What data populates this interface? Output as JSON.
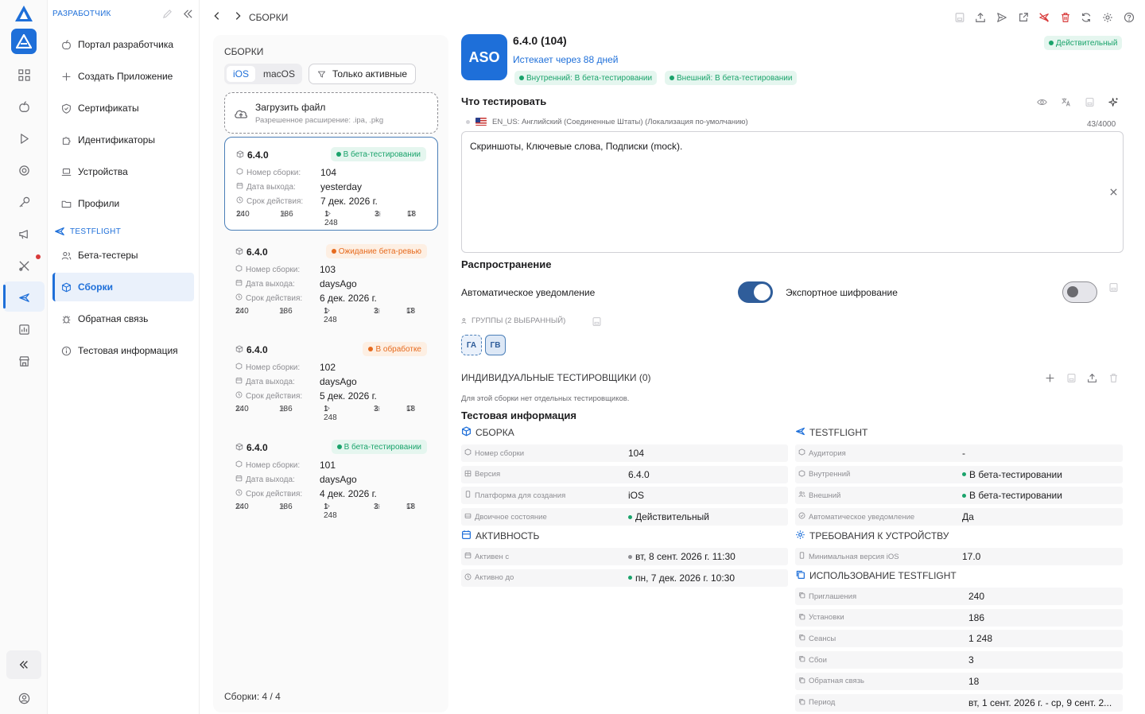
{
  "sidebar": {
    "section_title": "РАЗРАБОТЧИК",
    "items": [
      {
        "label": "Портал разработчика",
        "icon": "apple-icon"
      },
      {
        "label": "Создать Приложение",
        "icon": "plus-icon"
      },
      {
        "label": "Сертификаты",
        "icon": "shield-check-icon"
      },
      {
        "label": "Идентификаторы",
        "icon": "puzzle-icon"
      },
      {
        "label": "Устройства",
        "icon": "laptop-icon"
      },
      {
        "label": "Профили",
        "icon": "folder-icon"
      }
    ],
    "testflight_section": "TESTFLIGHT",
    "testflight_items": [
      {
        "label": "Бета-тестеры",
        "icon": "users-icon"
      },
      {
        "label": "Сборки",
        "icon": "box-icon",
        "active": true
      },
      {
        "label": "Обратная связь",
        "icon": "bug-icon"
      },
      {
        "label": "Тестовая информация",
        "icon": "info-icon"
      }
    ]
  },
  "topbar": {
    "breadcrumb": "СБОРКИ"
  },
  "builds": {
    "title": "СБОРКИ",
    "platforms": [
      "iOS",
      "macOS"
    ],
    "selected_platform": "iOS",
    "filter_label": "Только активные",
    "upload_title": "Загрузить файл",
    "upload_hint": "Разрешенное расширение: .ipa, .pkg",
    "labels": {
      "build_number": "Номер сборки:",
      "release_date": "Дата выхода:",
      "expiry": "Срок действия:"
    },
    "items": [
      {
        "version": "6.4.0",
        "status": "В бета-тестировании",
        "status_color": "green",
        "build": "104",
        "date": "yesterday",
        "expiry": "7 дек. 2026 г.",
        "users": "240",
        "downloads": "186",
        "sessions": "1 248",
        "crashes": "3",
        "feedback": "18"
      },
      {
        "version": "6.4.0",
        "status": "Ожидание бета-ревью",
        "status_color": "orange",
        "build": "103",
        "date": "daysAgo",
        "expiry": "6 дек. 2026 г.",
        "users": "240",
        "downloads": "186",
        "sessions": "1 248",
        "crashes": "3",
        "feedback": "18"
      },
      {
        "version": "6.4.0",
        "status": "В обработке",
        "status_color": "orange",
        "build": "102",
        "date": "daysAgo",
        "expiry": "5 дек. 2026 г.",
        "users": "240",
        "downloads": "186",
        "sessions": "1 248",
        "crashes": "3",
        "feedback": "18"
      },
      {
        "version": "6.4.0",
        "status": "В бета-тестировании",
        "status_color": "green",
        "build": "101",
        "date": "daysAgo",
        "expiry": "4 дек. 2026 г.",
        "users": "240",
        "downloads": "186",
        "sessions": "1 248",
        "crashes": "3",
        "feedback": "18"
      }
    ],
    "footer": "Сборки: 4 / 4"
  },
  "detail": {
    "app_icon_text": "ASO",
    "title": "6.4.0 (104)",
    "expires": "Истекает через 88 дней",
    "internal_pill": "Внутренний: В бета-тестировании",
    "external_pill": "Внешний: В бета-тестировании",
    "valid_badge": "Действительный",
    "what_to_test_title": "Что тестировать",
    "locale": "EN_US: Английский (Соединенные Штаты) (Локализация по-умолчанию)",
    "char_count": "43/4000",
    "what_to_test_text": "Скриншоты, Ключевые слова, Подписки (mock).",
    "distribution_title": "Распространение",
    "auto_notify_label": "Автоматическое уведомление",
    "auto_notify_on": true,
    "export_crypto_label": "Экспортное шифрование",
    "export_crypto_on": false,
    "groups_label": "ГРУППЫ (2 ВЫБРАННЫЙ)",
    "groups": [
      "ГА",
      "ГВ"
    ],
    "individual_title": "ИНДИВИДУАЛЬНЫЕ ТЕСТИРОВЩИКИ (0)",
    "individual_empty": "Для этой сборки нет отдельных тестировщиков.",
    "test_info_title": "Тестовая информация",
    "build_section": {
      "title": "СБОРКА",
      "rows": [
        {
          "k": "Номер сборки",
          "v": "104"
        },
        {
          "k": "Версия",
          "v": "6.4.0"
        },
        {
          "k": "Платформа для создания",
          "v": "iOS"
        },
        {
          "k": "Двоичное состояние",
          "v": "Действительный"
        }
      ]
    },
    "activity_section": {
      "title": "АКТИВНОСТЬ",
      "rows": [
        {
          "k": "Активен с",
          "v": "вт, 8 сент. 2026 г. 11:30"
        },
        {
          "k": "Активно до",
          "v": "пн, 7 дек. 2026 г. 10:30"
        }
      ]
    },
    "testflight_section": {
      "title": "TESTFLIGHT",
      "rows": [
        {
          "k": "Аудитория",
          "v": "-"
        },
        {
          "k": "Внутренний",
          "v": "В бета-тестировании"
        },
        {
          "k": "Внешний",
          "v": "В бета-тестировании"
        },
        {
          "k": "Автоматическое уведомление",
          "v": "Да"
        }
      ]
    },
    "device_section": {
      "title": "ТРЕБОВАНИЯ К УСТРОЙСТВУ",
      "rows": [
        {
          "k": "Минимальная версия iOS",
          "v": "17.0"
        }
      ]
    },
    "usage_section": {
      "title": "ИСПОЛЬЗОВАНИЕ TESTFLIGHT",
      "rows": [
        {
          "k": "Приглашения",
          "v": "240"
        },
        {
          "k": "Установки",
          "v": "186"
        },
        {
          "k": "Сеансы",
          "v": "1 248"
        },
        {
          "k": "Сбои",
          "v": "3"
        },
        {
          "k": "Обратная связь",
          "v": "18"
        },
        {
          "k": "Период",
          "v": "вт, 1 сент. 2026 г. - ср, 9 сент. 2..."
        }
      ]
    }
  },
  "colors": {
    "accent": "#1e6fd9",
    "green": "#1aa36b",
    "orange": "#e66b1f",
    "toggle_on": "#2f5d9a"
  }
}
